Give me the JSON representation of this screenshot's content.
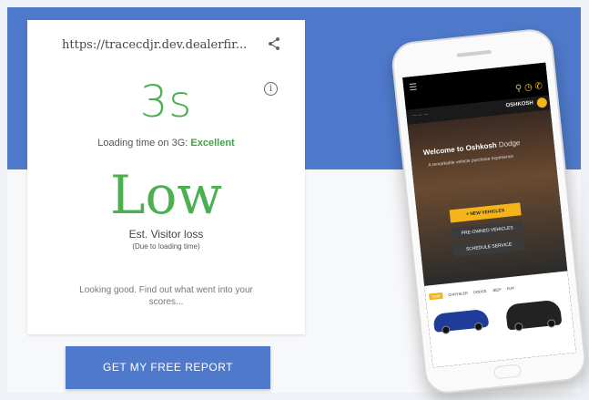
{
  "card": {
    "url": "https://tracecdjr.dev.dealerfir...",
    "load_time": "3s",
    "loading_prefix": "Loading time on 3G:",
    "loading_rating": "Excellent",
    "visitor_loss": "Low",
    "visitor_label": "Est. Visitor loss",
    "visitor_sub": "(Due to loading time)",
    "message": "Looking good. Find out what went into your scores...",
    "info_glyph": "i"
  },
  "report_button": {
    "label": "GET MY FREE REPORT"
  },
  "phone": {
    "brand": "OSHKOSH",
    "hero_title": "Welcome to Oshkosh",
    "hero_title_suffix": "Dodge",
    "hero_sub": "A remarkable vehicle purchase experience",
    "btn_new": "+ NEW VEHICLES",
    "btn_preowned": "PRE-OWNED VEHICLES",
    "btn_schedule": "SCHEDULE SERVICE",
    "brands": [
      "RAM",
      "CHRYSLER",
      "DODGE",
      "JEEP",
      "FIAT"
    ]
  },
  "colors": {
    "accent_blue": "#4f7acc",
    "score_green": "#4caf50",
    "dealer_yellow": "#f5b51a"
  },
  "icons": {
    "share": "share-icon",
    "info": "info-icon",
    "menu": "hamburger-icon"
  }
}
